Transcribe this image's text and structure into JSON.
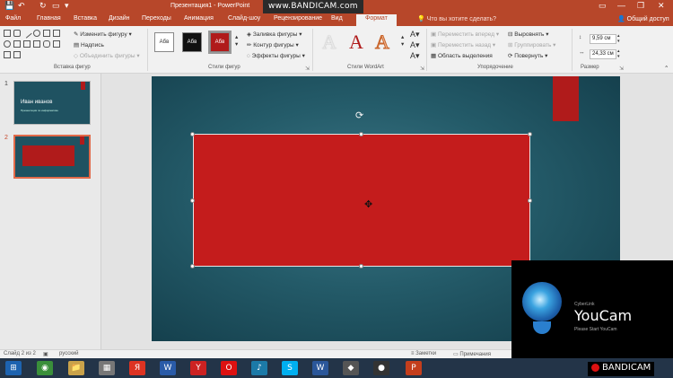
{
  "titlebar": {
    "title": "Презентация1 - PowerPoint",
    "watermark": "www.BANDICAM.com",
    "qa_save": "💾",
    "qa_undo": "↶",
    "qa_redo": "↻",
    "qa_present": "▭",
    "qa_more": "▾",
    "win_restore": "▭",
    "win_minimize": "—",
    "win_maximize": "❐",
    "win_close": "✕"
  },
  "tabs": [
    "Файл",
    "Главная",
    "Вставка",
    "Дизайн",
    "Переходы",
    "Анимация",
    "Слайд-шоу",
    "Рецензирование",
    "Вид"
  ],
  "active_tab": "Формат",
  "tell_me": "Что вы хотите сделать?",
  "share": "Общий доступ",
  "ribbon": {
    "insert_shapes": {
      "edit_shape": "Изменить фигуру",
      "text_box": "Надпись",
      "merge_shapes": "Объединить фигуры",
      "label": "Вставка фигур"
    },
    "shape_styles": {
      "swatch": "Абв",
      "fill": "Заливка фигуры",
      "outline": "Контур фигуры",
      "effects": "Эффекты фигуры",
      "label": "Стили фигур"
    },
    "wordart": {
      "letter": "A",
      "label": "Стили WordArt"
    },
    "arrange": {
      "bring_forward": "Переместить вперед",
      "send_backward": "Переместить назад",
      "selection_pane": "Область выделения",
      "align": "Выровнять",
      "group": "Группировать",
      "rotate": "Повернуть",
      "label": "Упорядочение"
    },
    "size": {
      "height": "9,59 см",
      "width": "24,33 см",
      "label": "Размер"
    }
  },
  "slides": {
    "numbers": [
      "1",
      "2"
    ],
    "thumb1_title": "Иван иванов",
    "thumb1_subtitle": "Презентация по информатике"
  },
  "youcam": {
    "small": "CyberLink",
    "brand": "YouCam",
    "start": "Please Start YouCam"
  },
  "bandicam_bottom": "BANDICAM",
  "status": {
    "slide_counter": "Слайд 2 из 2",
    "language": "русский",
    "notes": "Заметки",
    "comments": "Примечания"
  },
  "taskbar": {
    "apps": [
      "⊞",
      "◉",
      "📁",
      "▦",
      "Я",
      "W",
      "Y",
      "O",
      "♪",
      "S",
      "W",
      "◆",
      "●",
      "P"
    ]
  }
}
